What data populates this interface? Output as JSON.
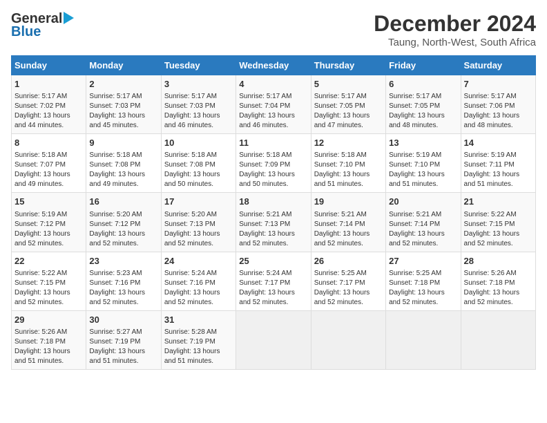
{
  "header": {
    "logo_general": "General",
    "logo_blue": "Blue",
    "title": "December 2024",
    "subtitle": "Taung, North-West, South Africa"
  },
  "calendar": {
    "days_of_week": [
      "Sunday",
      "Monday",
      "Tuesday",
      "Wednesday",
      "Thursday",
      "Friday",
      "Saturday"
    ],
    "weeks": [
      [
        {
          "day": "",
          "info": ""
        },
        {
          "day": "2",
          "info": "Sunrise: 5:17 AM\nSunset: 7:03 PM\nDaylight: 13 hours\nand 45 minutes."
        },
        {
          "day": "3",
          "info": "Sunrise: 5:17 AM\nSunset: 7:03 PM\nDaylight: 13 hours\nand 46 minutes."
        },
        {
          "day": "4",
          "info": "Sunrise: 5:17 AM\nSunset: 7:04 PM\nDaylight: 13 hours\nand 46 minutes."
        },
        {
          "day": "5",
          "info": "Sunrise: 5:17 AM\nSunset: 7:05 PM\nDaylight: 13 hours\nand 47 minutes."
        },
        {
          "day": "6",
          "info": "Sunrise: 5:17 AM\nSunset: 7:05 PM\nDaylight: 13 hours\nand 48 minutes."
        },
        {
          "day": "7",
          "info": "Sunrise: 5:17 AM\nSunset: 7:06 PM\nDaylight: 13 hours\nand 48 minutes."
        }
      ],
      [
        {
          "day": "8",
          "info": "Sunrise: 5:18 AM\nSunset: 7:07 PM\nDaylight: 13 hours\nand 49 minutes."
        },
        {
          "day": "9",
          "info": "Sunrise: 5:18 AM\nSunset: 7:08 PM\nDaylight: 13 hours\nand 49 minutes."
        },
        {
          "day": "10",
          "info": "Sunrise: 5:18 AM\nSunset: 7:08 PM\nDaylight: 13 hours\nand 50 minutes."
        },
        {
          "day": "11",
          "info": "Sunrise: 5:18 AM\nSunset: 7:09 PM\nDaylight: 13 hours\nand 50 minutes."
        },
        {
          "day": "12",
          "info": "Sunrise: 5:18 AM\nSunset: 7:10 PM\nDaylight: 13 hours\nand 51 minutes."
        },
        {
          "day": "13",
          "info": "Sunrise: 5:19 AM\nSunset: 7:10 PM\nDaylight: 13 hours\nand 51 minutes."
        },
        {
          "day": "14",
          "info": "Sunrise: 5:19 AM\nSunset: 7:11 PM\nDaylight: 13 hours\nand 51 minutes."
        }
      ],
      [
        {
          "day": "15",
          "info": "Sunrise: 5:19 AM\nSunset: 7:12 PM\nDaylight: 13 hours\nand 52 minutes."
        },
        {
          "day": "16",
          "info": "Sunrise: 5:20 AM\nSunset: 7:12 PM\nDaylight: 13 hours\nand 52 minutes."
        },
        {
          "day": "17",
          "info": "Sunrise: 5:20 AM\nSunset: 7:13 PM\nDaylight: 13 hours\nand 52 minutes."
        },
        {
          "day": "18",
          "info": "Sunrise: 5:21 AM\nSunset: 7:13 PM\nDaylight: 13 hours\nand 52 minutes."
        },
        {
          "day": "19",
          "info": "Sunrise: 5:21 AM\nSunset: 7:14 PM\nDaylight: 13 hours\nand 52 minutes."
        },
        {
          "day": "20",
          "info": "Sunrise: 5:21 AM\nSunset: 7:14 PM\nDaylight: 13 hours\nand 52 minutes."
        },
        {
          "day": "21",
          "info": "Sunrise: 5:22 AM\nSunset: 7:15 PM\nDaylight: 13 hours\nand 52 minutes."
        }
      ],
      [
        {
          "day": "22",
          "info": "Sunrise: 5:22 AM\nSunset: 7:15 PM\nDaylight: 13 hours\nand 52 minutes."
        },
        {
          "day": "23",
          "info": "Sunrise: 5:23 AM\nSunset: 7:16 PM\nDaylight: 13 hours\nand 52 minutes."
        },
        {
          "day": "24",
          "info": "Sunrise: 5:24 AM\nSunset: 7:16 PM\nDaylight: 13 hours\nand 52 minutes."
        },
        {
          "day": "25",
          "info": "Sunrise: 5:24 AM\nSunset: 7:17 PM\nDaylight: 13 hours\nand 52 minutes."
        },
        {
          "day": "26",
          "info": "Sunrise: 5:25 AM\nSunset: 7:17 PM\nDaylight: 13 hours\nand 52 minutes."
        },
        {
          "day": "27",
          "info": "Sunrise: 5:25 AM\nSunset: 7:18 PM\nDaylight: 13 hours\nand 52 minutes."
        },
        {
          "day": "28",
          "info": "Sunrise: 5:26 AM\nSunset: 7:18 PM\nDaylight: 13 hours\nand 52 minutes."
        }
      ],
      [
        {
          "day": "29",
          "info": "Sunrise: 5:26 AM\nSunset: 7:18 PM\nDaylight: 13 hours\nand 51 minutes."
        },
        {
          "day": "30",
          "info": "Sunrise: 5:27 AM\nSunset: 7:19 PM\nDaylight: 13 hours\nand 51 minutes."
        },
        {
          "day": "31",
          "info": "Sunrise: 5:28 AM\nSunset: 7:19 PM\nDaylight: 13 hours\nand 51 minutes."
        },
        {
          "day": "",
          "info": ""
        },
        {
          "day": "",
          "info": ""
        },
        {
          "day": "",
          "info": ""
        },
        {
          "day": "",
          "info": ""
        }
      ]
    ],
    "week0_day1": {
      "day": "1",
      "info": "Sunrise: 5:17 AM\nSunset: 7:02 PM\nDaylight: 13 hours\nand 44 minutes."
    }
  }
}
